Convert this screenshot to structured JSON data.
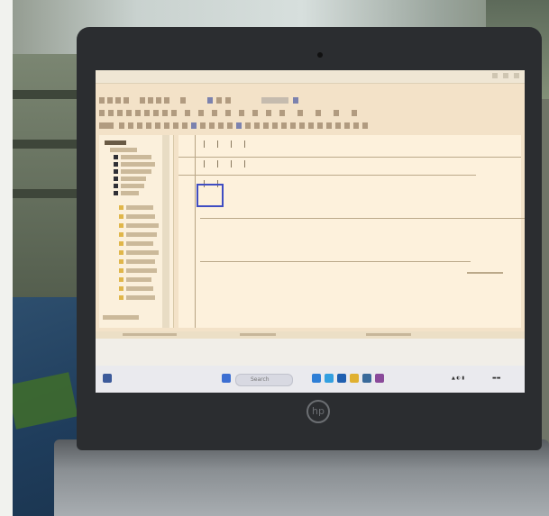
{
  "window": {
    "title": ""
  },
  "taskbar": {
    "search_label": "Search"
  },
  "icons": [
    "windows-start-icon",
    "search-icon",
    "file-explorer-icon",
    "edge-browser-icon",
    "store-icon",
    "app-icon",
    "hp-logo-icon"
  ],
  "colors": {
    "screen_bg": "#f3e2c8",
    "selection": "#3f4dc2",
    "laptop_bezel": "#2b2d30"
  }
}
